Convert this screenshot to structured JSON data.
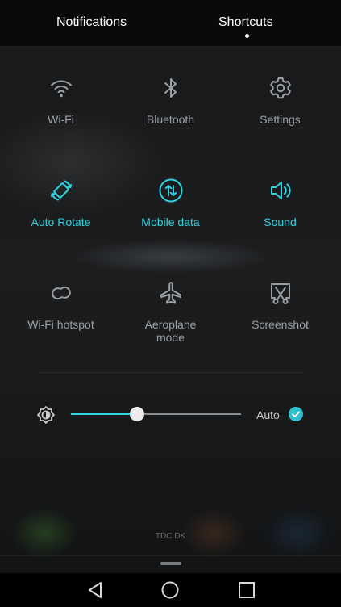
{
  "tabs": {
    "notifications": "Notifications",
    "shortcuts": "Shortcuts",
    "active": "Shortcuts"
  },
  "tiles": [
    {
      "label": "Wi-Fi",
      "icon": "wifi-icon",
      "on": false
    },
    {
      "label": "Bluetooth",
      "icon": "bluetooth-icon",
      "on": false
    },
    {
      "label": "Settings",
      "icon": "gear-icon",
      "on": false
    },
    {
      "label": "Auto Rotate",
      "icon": "auto-rotate-icon",
      "on": true
    },
    {
      "label": "Mobile data",
      "icon": "mobile-data-icon",
      "on": true
    },
    {
      "label": "Sound",
      "icon": "speaker-icon",
      "on": true
    },
    {
      "label": "Wi-Fi hotspot",
      "icon": "hotspot-icon",
      "on": false
    },
    {
      "label": "Aeroplane mode",
      "icon": "airplane-icon",
      "on": false
    },
    {
      "label": "Screenshot",
      "icon": "screenshot-icon",
      "on": false
    }
  ],
  "brightness": {
    "level": 0.39,
    "auto_label": "Auto",
    "auto_checked": true
  },
  "carrier": "TDC DK",
  "colors": {
    "accent": "#2fd4e2",
    "inactive": "#9da0a3",
    "background": "#121416"
  }
}
